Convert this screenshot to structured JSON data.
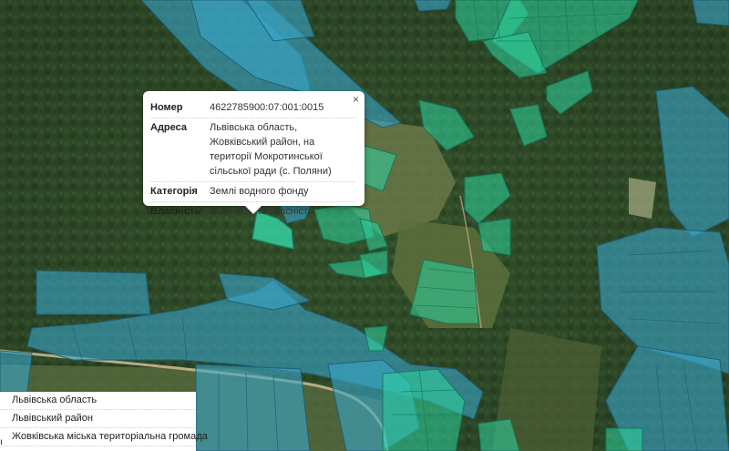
{
  "popup": {
    "close_label": "×",
    "rows": [
      {
        "label": "Номер",
        "value": "4622785900:07:001:0015"
      },
      {
        "label": "Адреса",
        "value": "Львівська область, Жовківський район, на території Мокротинської сільської ради (с. Поляни)"
      },
      {
        "label": "Категорія",
        "value": "Землі водного фонду"
      },
      {
        "label": "Власність",
        "value": "Комунальна власність"
      }
    ]
  },
  "admin_list": {
    "items": [
      "Львівська область",
      "Львівський район",
      "Жовківська міська територіальна громада"
    ],
    "marker": "ı"
  },
  "colors": {
    "forest": "#2f4a2a",
    "parcel_blue": "#3aa6c9",
    "parcel_green": "#2fd6a0",
    "selected_parcel": "#35e0b0",
    "road": "#c9b68f"
  }
}
